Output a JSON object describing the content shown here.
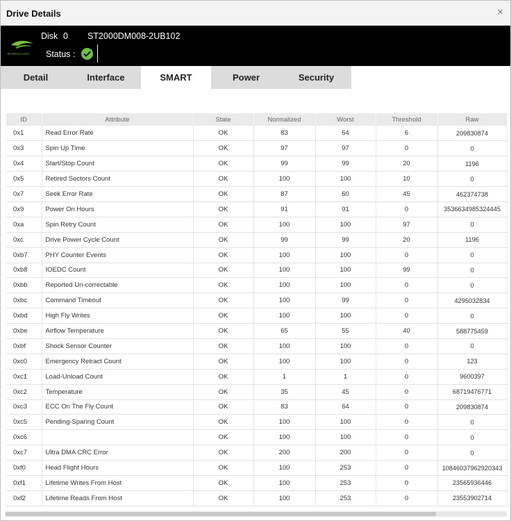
{
  "window": {
    "title": "Drive Details",
    "close_glyph": "×"
  },
  "drive": {
    "disk_label": "Disk",
    "disk_number": "0",
    "model": "ST2000DM008-2UB102",
    "status_label": "Status :",
    "status_icon": "check-circle-icon",
    "status_color": "#6cc04a",
    "logo_text": "BARRACUDA",
    "logo_color": "#7fbf3f"
  },
  "tabs": [
    {
      "label": "Detail"
    },
    {
      "label": "Interface"
    },
    {
      "label": "SMART"
    },
    {
      "label": "Power"
    },
    {
      "label": "Security"
    }
  ],
  "active_tab": "SMART",
  "table": {
    "columns": [
      "ID",
      "Attribute",
      "State",
      "Normalized",
      "Worst",
      "Threshold",
      "Raw"
    ],
    "rows": [
      [
        "0x1",
        "Read Error Rate",
        "OK",
        "83",
        "64",
        "6",
        "209830874"
      ],
      [
        "0x3",
        "Spin Up Time",
        "OK",
        "97",
        "97",
        "0",
        "0"
      ],
      [
        "0x4",
        "Start/Stop Count",
        "OK",
        "99",
        "99",
        "20",
        "1196"
      ],
      [
        "0x5",
        "Retired Sectors Count",
        "OK",
        "100",
        "100",
        "10",
        "0"
      ],
      [
        "0x7",
        "Seek Error Rate",
        "OK",
        "87",
        "60",
        "45",
        "462374738"
      ],
      [
        "0x9",
        "Power On Hours",
        "OK",
        "91",
        "91",
        "0",
        "3536634985324445"
      ],
      [
        "0xa",
        "Spin Retry Count",
        "OK",
        "100",
        "100",
        "97",
        "0"
      ],
      [
        "0xc",
        "Drive Power Cycle Count",
        "OK",
        "99",
        "99",
        "20",
        "1196"
      ],
      [
        "0xb7",
        "PHY Counter Events",
        "OK",
        "100",
        "100",
        "0",
        "0"
      ],
      [
        "0xb8",
        "IOEDC Count",
        "OK",
        "100",
        "100",
        "99",
        "0"
      ],
      [
        "0xbb",
        "Reported Un-correctable",
        "OK",
        "100",
        "100",
        "0",
        "0"
      ],
      [
        "0xbc",
        "Command Timeout",
        "OK",
        "100",
        "99",
        "0",
        "4295032834"
      ],
      [
        "0xbd",
        "High Fly Writes",
        "OK",
        "100",
        "100",
        "0",
        "0"
      ],
      [
        "0xbe",
        "Airflow Temperature",
        "OK",
        "65",
        "55",
        "40",
        "588775459"
      ],
      [
        "0xbf",
        "Shock Sensor Counter",
        "OK",
        "100",
        "100",
        "0",
        "0"
      ],
      [
        "0xc0",
        "Emergency Retract Count",
        "OK",
        "100",
        "100",
        "0",
        "123"
      ],
      [
        "0xc1",
        "Load-Unload Count",
        "OK",
        "1",
        "1",
        "0",
        "9600397"
      ],
      [
        "0xc2",
        "Temperature",
        "OK",
        "35",
        "45",
        "0",
        "68719476771"
      ],
      [
        "0xc3",
        "ECC On The Fly Count",
        "OK",
        "83",
        "64",
        "0",
        "209830874"
      ],
      [
        "0xc5",
        "Pending-Sparing Count",
        "OK",
        "100",
        "100",
        "0",
        "0"
      ],
      [
        "0xc6",
        "",
        "OK",
        "100",
        "100",
        "0",
        "0"
      ],
      [
        "0xc7",
        "Ultra DMA CRC Error",
        "OK",
        "200",
        "200",
        "0",
        "0"
      ],
      [
        "0xf0",
        "Head Flight Hours",
        "OK",
        "100",
        "253",
        "0",
        "108460379629203​43"
      ],
      [
        "0xf1",
        "Lifetime Writes From Host",
        "OK",
        "100",
        "253",
        "0",
        "23565936446"
      ],
      [
        "0xf2",
        "Lifetime Reads From Host",
        "OK",
        "100",
        "253",
        "0",
        "23553902714"
      ]
    ]
  }
}
